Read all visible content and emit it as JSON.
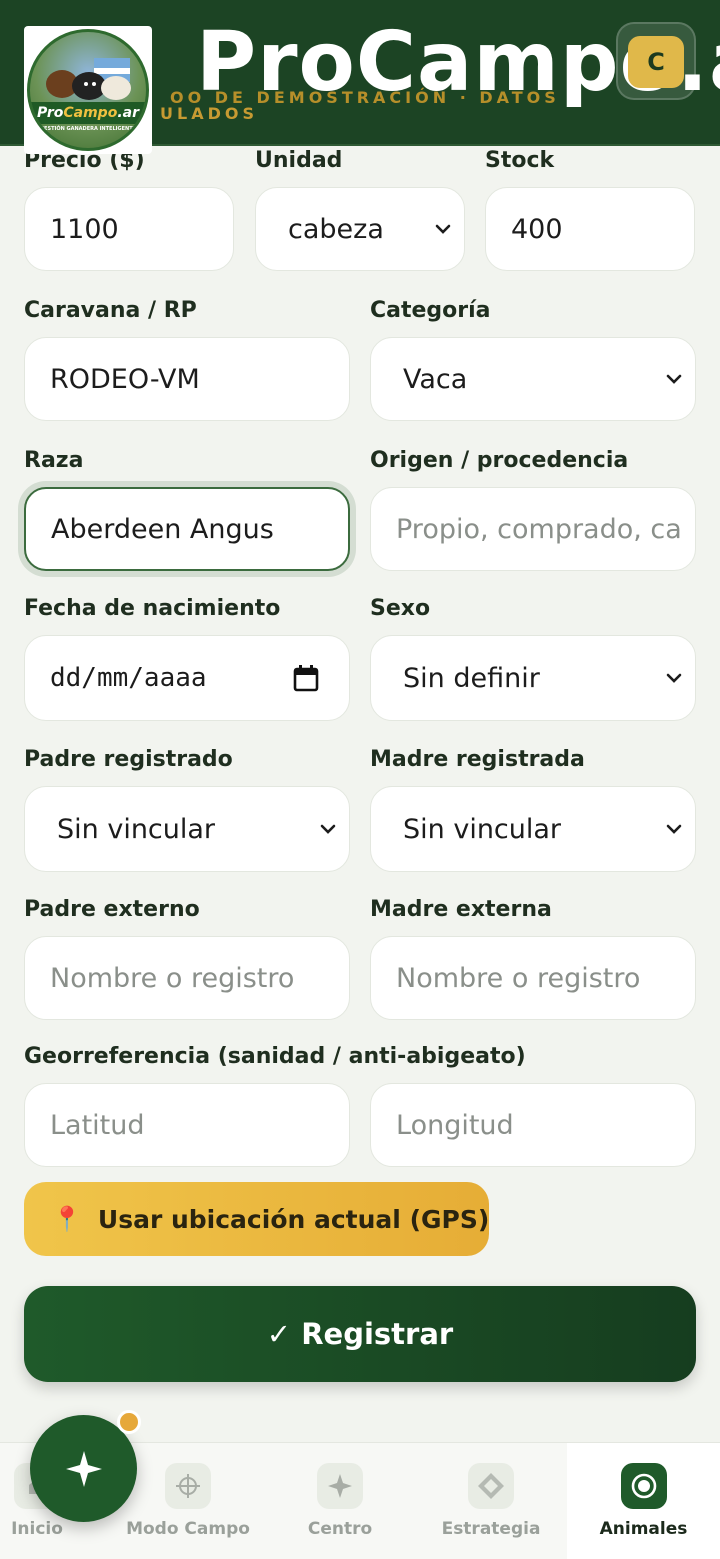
{
  "header": {
    "brand": "ProCampo.ar",
    "subtitle_partial": "ULADOS",
    "subtitle_top": "OO DE DEMOSTRACIÓN · DATOS",
    "user_initial": "C",
    "logo_text_main": "Pro",
    "logo_text_accent": "Campo",
    "logo_text_suffix": ".ar",
    "logo_tagline": "GESTIÓN GANADERA INTELIGENTE"
  },
  "form": {
    "precio": {
      "label": "Precio ($)",
      "value": "1100"
    },
    "unidad": {
      "label": "Unidad",
      "value": "cabeza"
    },
    "stock": {
      "label": "Stock",
      "value": "400"
    },
    "caravana": {
      "label": "Caravana / RP",
      "value": "RODEO-VM"
    },
    "categoria": {
      "label": "Categoría",
      "value": "Vaca"
    },
    "raza": {
      "label": "Raza",
      "value": "Aberdeen Angus"
    },
    "origen": {
      "label": "Origen / procedencia",
      "placeholder": "Propio, comprado, ca"
    },
    "fecha": {
      "label": "Fecha de nacimiento",
      "placeholder": "dd/mm/aaaa"
    },
    "sexo": {
      "label": "Sexo",
      "value": "Sin definir"
    },
    "padre_reg": {
      "label": "Padre registrado",
      "value": "Sin vincular"
    },
    "madre_reg": {
      "label": "Madre registrada",
      "value": "Sin vincular"
    },
    "padre_ext": {
      "label": "Padre externo",
      "placeholder": "Nombre o registro"
    },
    "madre_ext": {
      "label": "Madre externa",
      "placeholder": "Nombre o registro"
    },
    "geo": {
      "label": "Georreferencia (sanidad / anti-abigeato)"
    },
    "latitud": {
      "placeholder": "Latitud"
    },
    "longitud": {
      "placeholder": "Longitud"
    },
    "gps_button": "Usar ubicación actual (GPS)",
    "submit_button": "✓ Registrar"
  },
  "nav": {
    "items": [
      {
        "label": "Inicio"
      },
      {
        "label": "Modo Campo"
      },
      {
        "label": "Centro"
      },
      {
        "label": "Estrategia"
      },
      {
        "label": "Animales"
      }
    ]
  },
  "colors": {
    "header_bg": "#1c4424",
    "primary": "#1f5a2a",
    "accent": "#e6ad36"
  }
}
